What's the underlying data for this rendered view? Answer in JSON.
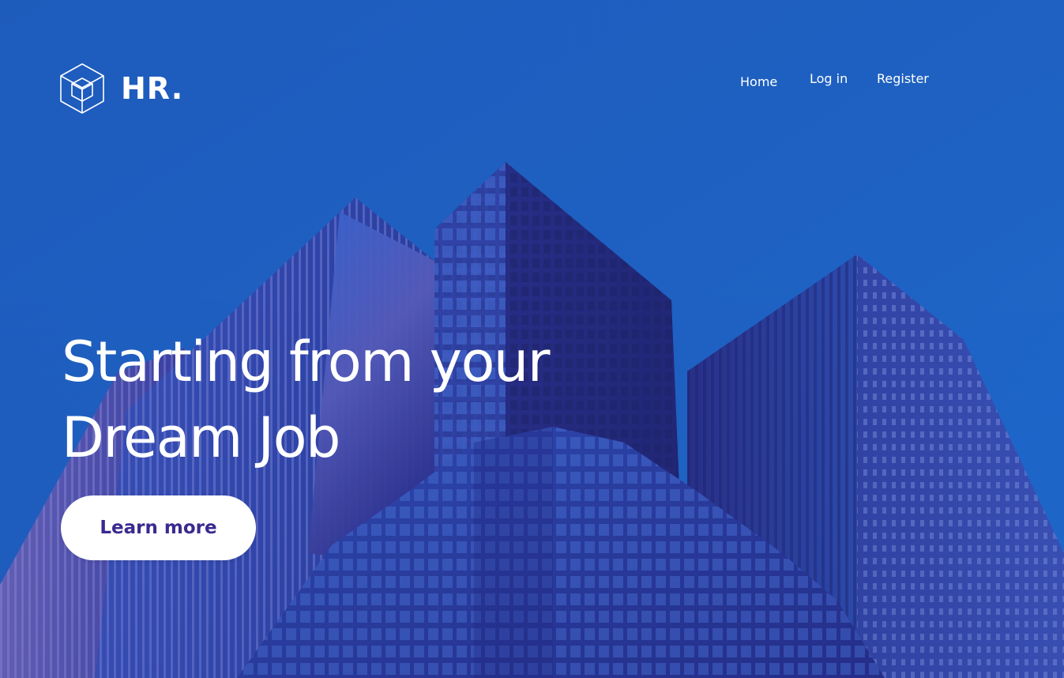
{
  "brand": {
    "name": "HR.",
    "icon": "cube-icon"
  },
  "nav": {
    "items": [
      {
        "label": "Home"
      },
      {
        "label": "Log in"
      },
      {
        "label": "Register"
      }
    ]
  },
  "hero": {
    "headline_line1": "Starting from your",
    "headline_line2": "Dream Job",
    "cta_label": "Learn more"
  },
  "colors": {
    "sky": "#1f5fbf",
    "building_dark": "#2a2e8c",
    "building_glass": "#3a57c8",
    "cta_background": "#ffffff",
    "cta_text": "#3a2a8f",
    "text": "#ffffff"
  }
}
